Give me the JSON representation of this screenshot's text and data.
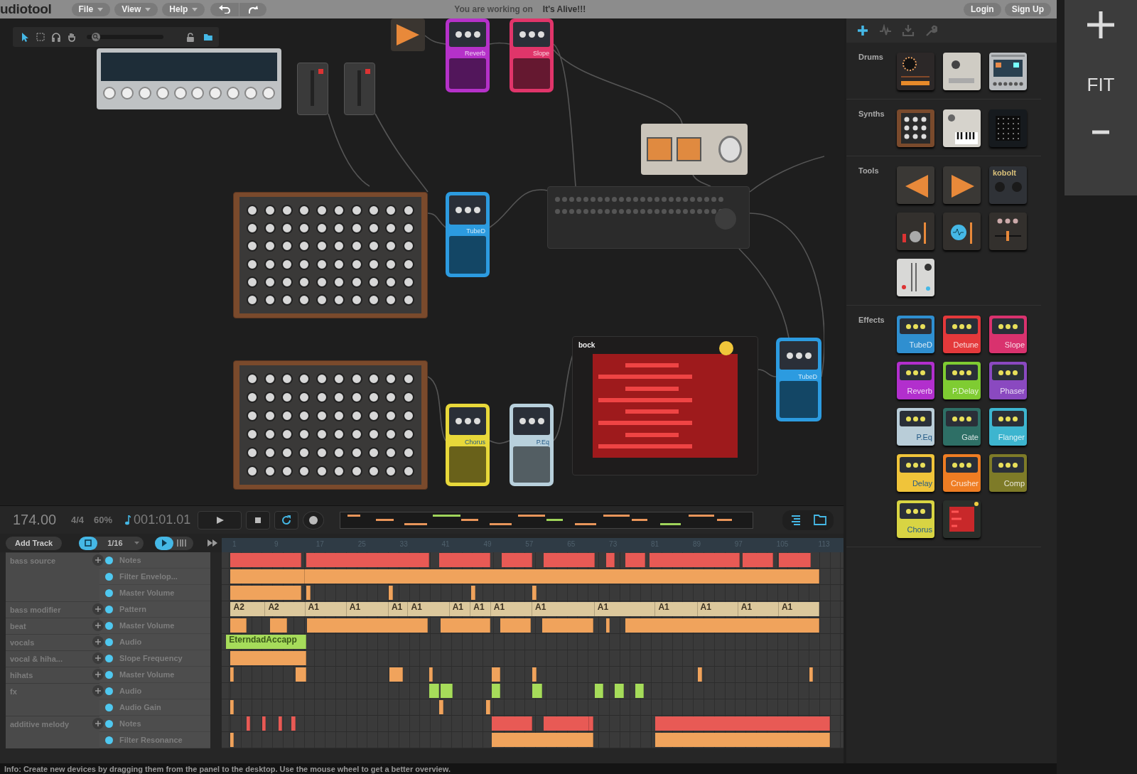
{
  "topbar": {
    "logo": "udiotool",
    "menus": [
      "File",
      "View",
      "Help"
    ],
    "working_label": "You are working on",
    "project_title": "It's Alive!!!",
    "auth": [
      "Login",
      "Sign Up"
    ]
  },
  "desktop": {
    "tools": [
      {
        "kind": "pointer",
        "selected": true
      },
      {
        "kind": "marquee",
        "selected": false
      },
      {
        "kind": "listen",
        "selected": false
      },
      {
        "kind": "hand",
        "selected": false
      }
    ],
    "zoom_slider": {
      "level": 0.06
    },
    "devices": [
      {
        "kind": "beatbox"
      },
      {
        "kind": "channel"
      },
      {
        "kind": "channel"
      },
      {
        "kind": "splitter"
      },
      {
        "kind": "pedal",
        "label": "Reverb",
        "color": "#b531c9"
      },
      {
        "kind": "pedal",
        "label": "Slope",
        "color": "#e0356a"
      },
      {
        "kind": "vu-meter"
      },
      {
        "kind": "synth"
      },
      {
        "kind": "pedal",
        "label": "TubeD",
        "color": "#2c9be0"
      },
      {
        "kind": "mixer"
      },
      {
        "kind": "synth"
      },
      {
        "kind": "pedal",
        "label": "Chorus",
        "color": "#e8d83a"
      },
      {
        "kind": "pedal",
        "label": "P.Eq",
        "color": "#b8d0dc"
      },
      {
        "kind": "sampler",
        "label": "bock"
      },
      {
        "kind": "pedal",
        "label": "TubeD",
        "color": "#2c9be0"
      }
    ]
  },
  "transport": {
    "tempo": "174.00",
    "signature": "4/4",
    "swing": "60%",
    "position": "001:01.01",
    "buttons": [
      {
        "kind": "play",
        "on": false
      },
      {
        "kind": "stop",
        "on": false
      },
      {
        "kind": "loop",
        "on": true
      },
      {
        "kind": "record",
        "on": false
      }
    ]
  },
  "timeline": {
    "add_track": "Add Track",
    "snap": {
      "on": true
    },
    "snap_value": "1/16",
    "follow": {
      "on": true
    },
    "ruler": [
      "1",
      "9",
      "17",
      "25",
      "33",
      "41",
      "49",
      "57",
      "65",
      "73",
      "81",
      "89",
      "97",
      "105",
      "113"
    ],
    "tracks": [
      {
        "name": "bass source",
        "lanes": [
          {
            "label": "Notes",
            "kind": "notes"
          },
          {
            "label": "Filter Envelop...",
            "kind": "automation"
          },
          {
            "label": "Master Volume",
            "kind": "automation"
          }
        ]
      },
      {
        "name": "bass modifier",
        "lanes": [
          {
            "label": "Pattern",
            "kind": "pattern",
            "clips": [
              "A2",
              "A2",
              "A1",
              "A1",
              "A1",
              "A1",
              "A1",
              "A1",
              "A1",
              "A1",
              "A1",
              "A1",
              "A1",
              "A1",
              "A1"
            ]
          }
        ]
      },
      {
        "name": "beat",
        "lanes": [
          {
            "label": "Master Volume",
            "kind": "automation"
          }
        ]
      },
      {
        "name": "vocals",
        "lanes": [
          {
            "label": "Audio",
            "kind": "audio",
            "clips": [
              "EterndadAccapp"
            ]
          }
        ]
      },
      {
        "name": "vocal & hiha...",
        "lanes": [
          {
            "label": "Slope Frequency",
            "kind": "automation"
          }
        ]
      },
      {
        "name": "hihats",
        "lanes": [
          {
            "label": "Master Volume",
            "kind": "automation"
          }
        ]
      },
      {
        "name": "fx",
        "lanes": [
          {
            "label": "Audio",
            "kind": "audio"
          },
          {
            "label": "Audio Gain",
            "kind": "automation"
          }
        ]
      },
      {
        "name": "additive melody",
        "lanes": [
          {
            "label": "Notes",
            "kind": "notes"
          },
          {
            "label": "Filter Resonance",
            "kind": "automation"
          }
        ]
      }
    ]
  },
  "panel": {
    "tabs": [
      {
        "kind": "add",
        "selected": true
      },
      {
        "kind": "waveform",
        "selected": false
      },
      {
        "kind": "download",
        "selected": false
      },
      {
        "kind": "wrench",
        "selected": false
      }
    ],
    "sections": [
      {
        "title": "Drums",
        "tiles": [
          {
            "kind": "drum-ring"
          },
          {
            "kind": "beat-light"
          },
          {
            "kind": "screen-pad"
          }
        ]
      },
      {
        "title": "Synths",
        "tiles": [
          {
            "kind": "knob-synth"
          },
          {
            "kind": "keys"
          },
          {
            "kind": "matrix"
          }
        ]
      },
      {
        "title": "Tools",
        "tiles": [
          {
            "kind": "split-left"
          },
          {
            "kind": "split-right"
          },
          {
            "kind": "kobolt",
            "label": "kobolt"
          },
          {
            "kind": "channel-strip"
          },
          {
            "kind": "wave-meter"
          },
          {
            "kind": "eq-strip"
          },
          {
            "kind": "mixer-light"
          }
        ]
      },
      {
        "title": "Effects",
        "tiles": [
          {
            "kind": "pedal",
            "label": "TubeD",
            "color": "#2f8fd0"
          },
          {
            "kind": "pedal",
            "label": "Detune",
            "color": "#e4393b"
          },
          {
            "kind": "pedal",
            "label": "Slope",
            "color": "#d9326e"
          },
          {
            "kind": "pedal",
            "label": "Reverb",
            "color": "#b22fcd"
          },
          {
            "kind": "pedal",
            "label": "P.Delay",
            "color": "#7fcc32"
          },
          {
            "kind": "pedal",
            "label": "Phaser",
            "color": "#8a49c0"
          },
          {
            "kind": "pedal",
            "label": "P.Eq",
            "color": "#b9cdd8"
          },
          {
            "kind": "pedal",
            "label": "Gate",
            "color": "#2e6f66"
          },
          {
            "kind": "pedal",
            "label": "Flanger",
            "color": "#3db5cf"
          },
          {
            "kind": "pedal",
            "label": "Delay",
            "color": "#f0c43a"
          },
          {
            "kind": "pedal",
            "label": "Crusher",
            "color": "#ef7d23"
          },
          {
            "kind": "pedal",
            "label": "Comp",
            "color": "#7e7b28"
          },
          {
            "kind": "pedal",
            "label": "Chorus",
            "color": "#d8d443"
          },
          {
            "kind": "sampler"
          }
        ]
      }
    ]
  },
  "zoom": {
    "fit": "FIT"
  },
  "status_bar": "Info: Create new devices by dragging them from the panel to the desktop. Use the mouse wheel to get a better overview."
}
